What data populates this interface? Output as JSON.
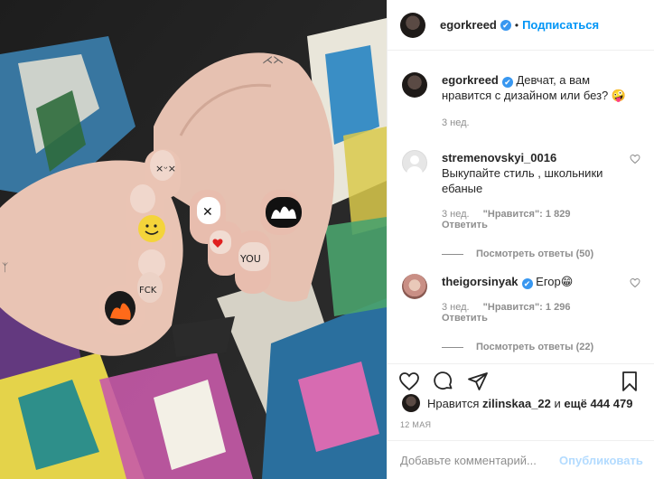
{
  "post": {
    "author": "egorkreed",
    "follow_label": "Подписаться",
    "dot": "•",
    "verified_icon": "✔"
  },
  "comments": [
    {
      "username": "egorkreed",
      "text": "Девчат, а вам нравится с дизайном или без? 🤪",
      "time": "3 нед."
    },
    {
      "username": "stremenovskyi_0016",
      "text": "Выкупайте стиль , школьники ебаные",
      "time": "3 нед.",
      "likes": "\"Нравится\": 1 829",
      "reply_label": "Ответить",
      "view_replies": "Посмотреть ответы (50)"
    },
    {
      "username": "theigorsinyak",
      "text": "Егор😁",
      "time": "3 нед.",
      "likes": "\"Нравится\": 1 296",
      "reply_label": "Ответить",
      "view_replies": "Посмотреть ответы (22)"
    }
  ],
  "likes_line": {
    "prefix": "Нравится",
    "user": "zilinskaa_22",
    "middle": "и",
    "rest": "ещё 444 479"
  },
  "date": "12 МАЯ",
  "add_comment": {
    "placeholder": "Добавьте комментарий...",
    "publish_label": "Опубликовать"
  },
  "icons": [
    "heart-icon",
    "comment-icon",
    "share-icon",
    "bookmark-icon"
  ],
  "colors": {
    "link_blue": "#0095f6",
    "verified": "#3897f0",
    "muted": "#8e8e8e",
    "publish_disabled": "#b3dbff"
  }
}
